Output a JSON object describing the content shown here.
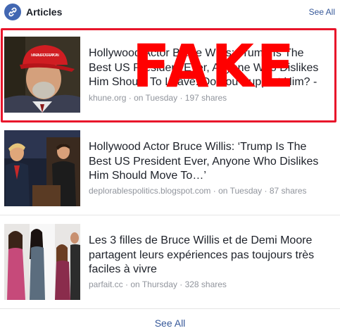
{
  "header": {
    "icon": "link-icon",
    "title": "Articles",
    "see_all": "See All"
  },
  "articles": [
    {
      "title": "Hollywood Actor Bruce Willis: Trump Is The Best US President Ever, Anyone Who Dislikes Him Should To Leave. Do You Support Him? -",
      "source": "khune.org",
      "time": "on Tuesday",
      "shares": "197 shares",
      "flag": "FAKE"
    },
    {
      "title": "Hollywood Actor Bruce Willis: ‘Trump Is The Best US President Ever, Anyone Who Dislikes Him Should Move To…’",
      "source": "deplorablespolitics.blogspot.com",
      "time": "on Tuesday",
      "shares": "87 shares"
    },
    {
      "title": "Les 3 filles de Bruce Willis et de Demi Moore partagent leurs expériences pas toujours très faciles à vivre",
      "source": "parfait.cc",
      "time": "on Thursday",
      "shares": "328 shares"
    }
  ],
  "thumbnail_text": {
    "cap": "MAKE AMERICA GREAT AGAIN"
  },
  "footer": {
    "see_all": "See All"
  },
  "colors": {
    "link": "#365899",
    "meta": "#90949c",
    "fake_red": "#ff0000",
    "border_red": "#e8152b"
  }
}
